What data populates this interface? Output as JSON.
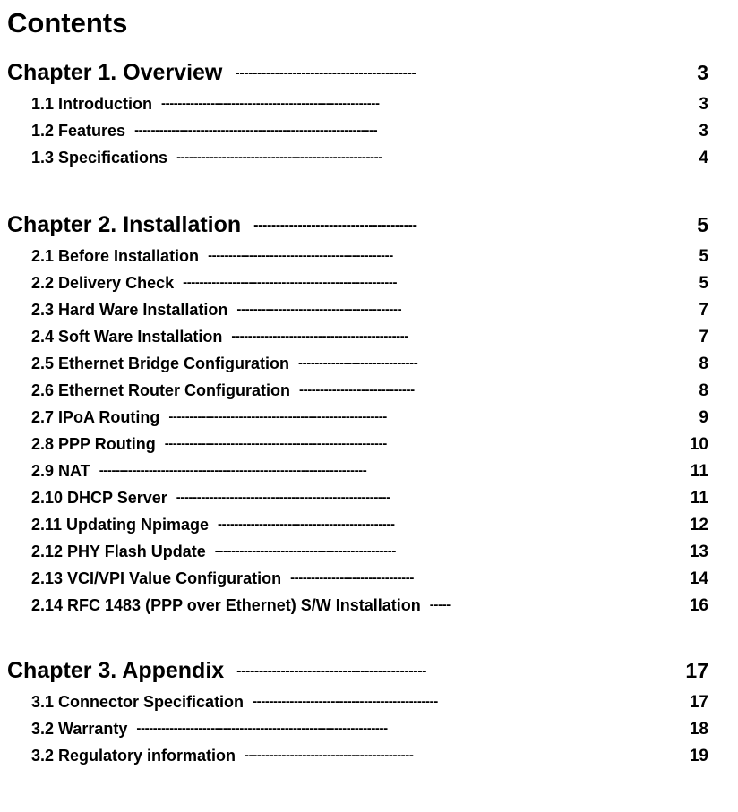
{
  "document": {
    "title": "Contents"
  },
  "toc": {
    "chapters": [
      {
        "label": "Chapter 1. Overview",
        "leader": "-----------------------------------------",
        "page": "3",
        "sections": [
          {
            "label": "1.1  Introduction",
            "leader": "-----------------------------------------------------",
            "page": "3"
          },
          {
            "label": "1.2  Features",
            "leader": "-----------------------------------------------------------",
            "page": "3"
          },
          {
            "label": "1.3  Specifications",
            "leader": "--------------------------------------------------",
            "page": "4"
          }
        ]
      },
      {
        "label": "Chapter 2. Installation",
        "leader": "-------------------------------------",
        "page": "5",
        "sections": [
          {
            "label": "2.1  Before  Installation",
            "leader": "---------------------------------------------",
            "page": "5"
          },
          {
            "label": "2.2 Delivery Check",
            "leader": "----------------------------------------------------",
            "page": "5"
          },
          {
            "label": "2.3 Hard  Ware  Installation",
            "leader": "----------------------------------------",
            "page": "7"
          },
          {
            "label": "2.4 Soft  Ware  Installation",
            "leader": "-------------------------------------------",
            "page": "7"
          },
          {
            "label": "2.5 Ethernet Bridge Configuration",
            "leader": "-----------------------------",
            "page": "8"
          },
          {
            "label": "2.6 Ethernet  Router  Configuration",
            "leader": "----------------------------",
            "page": "8"
          },
          {
            "label": "2.7 IPoA Routing",
            "leader": "-----------------------------------------------------",
            "page": "9"
          },
          {
            "label": "2.8 PPP Routing",
            "leader": "------------------------------------------------------",
            "page": "10"
          },
          {
            "label": "2.9  NAT",
            "leader": "-----------------------------------------------------------------",
            "page": "11"
          },
          {
            "label": "2.10  DHCP  Server",
            "leader": "----------------------------------------------------",
            "page": "11"
          },
          {
            "label": "2.11  Updating  Npimage",
            "leader": "-------------------------------------------",
            "page": "12"
          },
          {
            "label": "2.12  PHY  Flash  Update",
            "leader": "--------------------------------------------",
            "page": "13"
          },
          {
            "label": "2.13  VCI/VPI  Value  Configuration",
            "leader": "------------------------------",
            "page": "14"
          },
          {
            "label": "2.14 RFC 1483 (PPP over Ethernet) S/W Installation",
            "leader": "-----",
            "page": "16"
          }
        ]
      },
      {
        "label": "Chapter 3. Appendix",
        "leader": "-------------------------------------------",
        "page": "17",
        "sections": [
          {
            "label": "3.1 Connector Specification",
            "leader": "---------------------------------------------",
            "page": "17"
          },
          {
            "label": "3.2 Warranty",
            "leader": "-------------------------------------------------------------",
            "page": "18"
          },
          {
            "label": "3.2 Regulatory information",
            "leader": "-----------------------------------------",
            "page": "19"
          }
        ]
      }
    ]
  }
}
